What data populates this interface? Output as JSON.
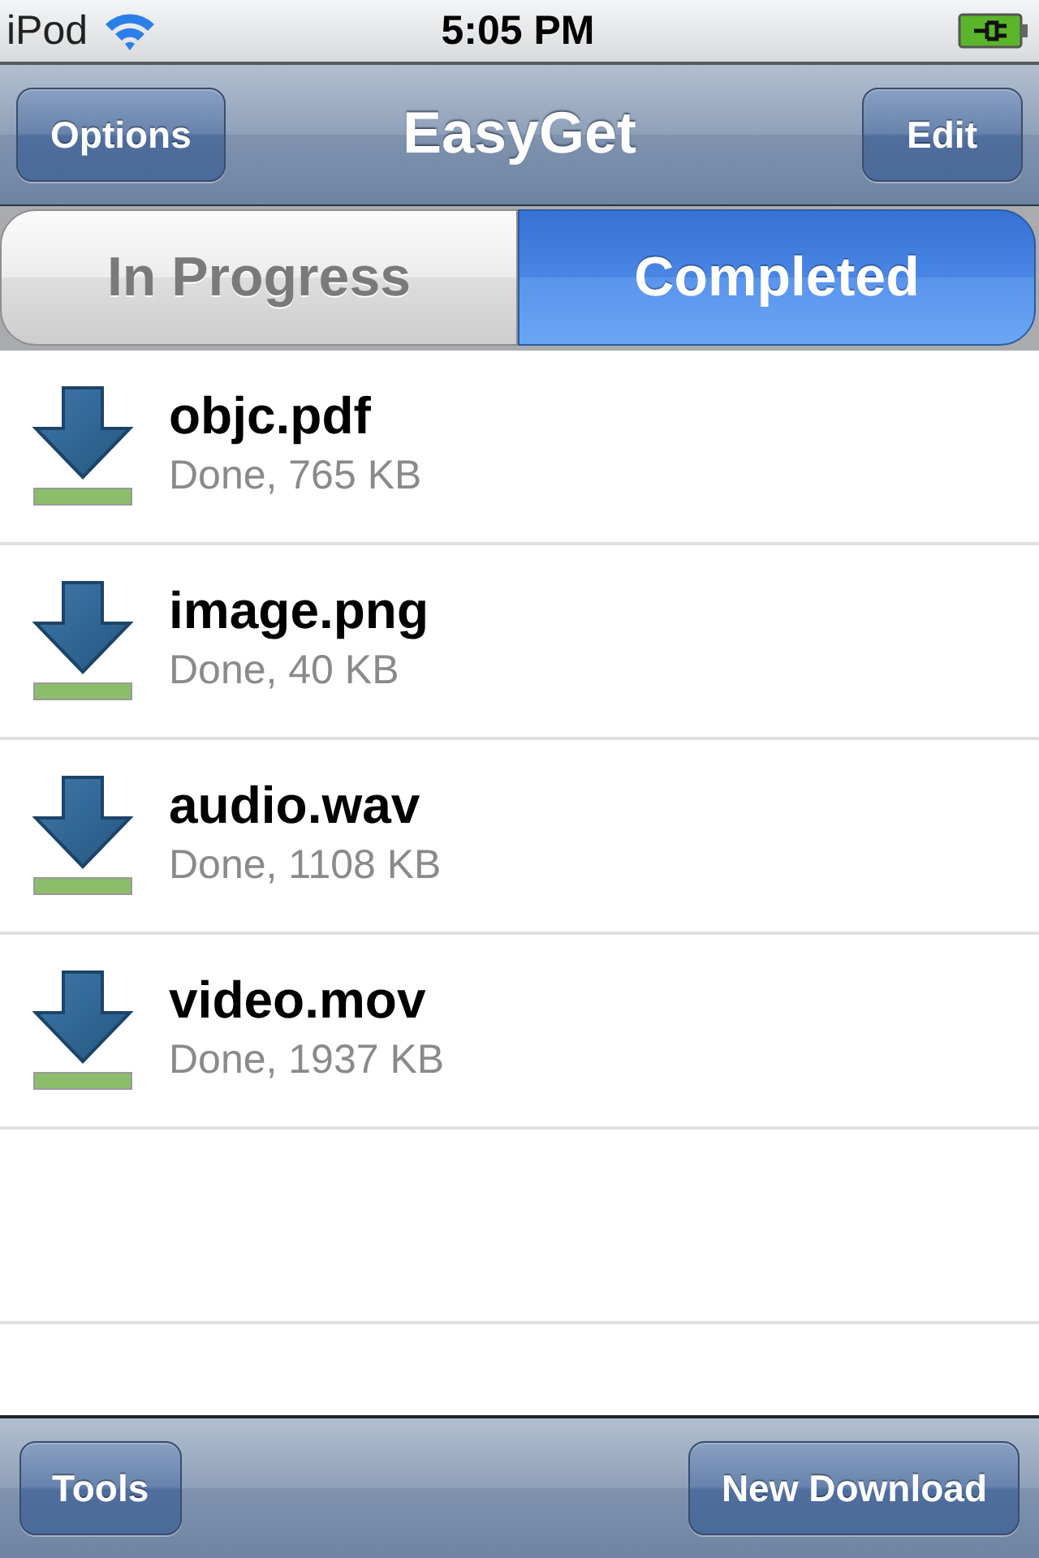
{
  "status_bar": {
    "carrier": "iPod",
    "time": "5:05 PM"
  },
  "nav_bar": {
    "title": "EasyGet",
    "left_button": "Options",
    "right_button": "Edit"
  },
  "segments": [
    {
      "label": "In Progress",
      "selected": false
    },
    {
      "label": "Completed",
      "selected": true
    }
  ],
  "downloads": [
    {
      "name": "objc.pdf",
      "status": "Done, 765 KB"
    },
    {
      "name": "image.png",
      "status": "Done, 40 KB"
    },
    {
      "name": "audio.wav",
      "status": "Done, 1108 KB"
    },
    {
      "name": "video.mov",
      "status": "Done, 1937 KB"
    }
  ],
  "toolbar": {
    "left_button": "Tools",
    "right_button": "New Download"
  }
}
